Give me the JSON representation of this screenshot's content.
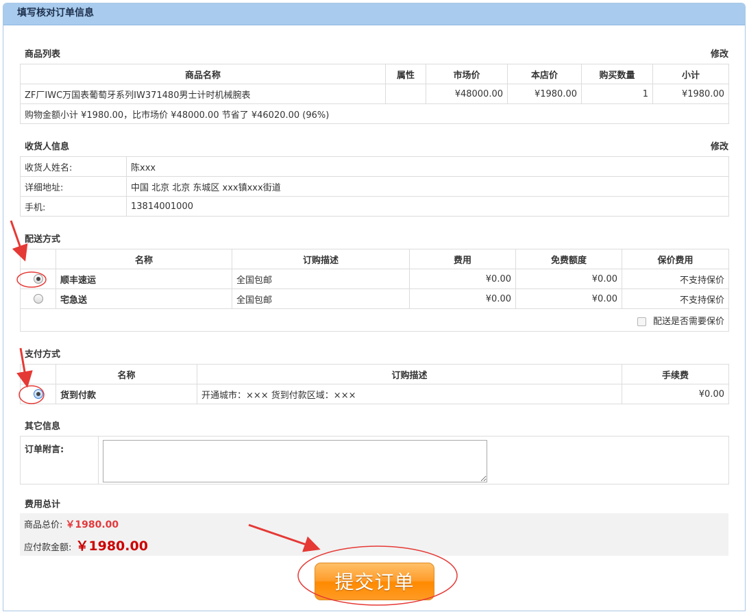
{
  "header": {
    "title": "填写核对订单信息"
  },
  "goods": {
    "title": "商品列表",
    "edit_label": "修改",
    "columns": [
      "商品名称",
      "属性",
      "市场价",
      "本店价",
      "购买数量",
      "小计"
    ],
    "rows": [
      {
        "name": "ZF厂IWC万国表葡萄牙系列IW371480男士计时机械腕表",
        "attr": "",
        "market": "¥48000.00",
        "shop": "¥1980.00",
        "qty": "1",
        "subtotal": "¥1980.00"
      }
    ],
    "summary": "购物金额小计 ¥1980.00，比市场价 ¥48000.00 节省了 ¥46020.00 (96%)"
  },
  "consignee": {
    "title": "收货人信息",
    "edit_label": "修改",
    "rows": [
      {
        "label": "收货人姓名:",
        "value": "陈xxx"
      },
      {
        "label": "详细地址:",
        "value": "中国 北京 北京 东城区 xxx镇xxx街道"
      },
      {
        "label": "手机:",
        "value": "13814001000"
      }
    ]
  },
  "shipping": {
    "title": "配送方式",
    "columns": [
      "名称",
      "订购描述",
      "费用",
      "免费额度",
      "保价费用"
    ],
    "rows": [
      {
        "name": "顺丰速运",
        "desc": "全国包邮",
        "fee": "¥0.00",
        "free": "¥0.00",
        "insure": "不支持保价",
        "selected": true
      },
      {
        "name": "宅急送",
        "desc": "全国包邮",
        "fee": "¥0.00",
        "free": "¥0.00",
        "insure": "不支持保价",
        "selected": false
      }
    ],
    "insure_label": "配送是否需要保价"
  },
  "payment": {
    "title": "支付方式",
    "columns": [
      "名称",
      "订购描述",
      "手续费"
    ],
    "rows": [
      {
        "name": "货到付款",
        "desc": "开通城市：××× 货到付款区域：×××",
        "fee": "¥0.00",
        "selected": true
      }
    ]
  },
  "other": {
    "title": "其它信息",
    "note_label": "订单附言:"
  },
  "total": {
    "title": "费用总计",
    "goods_label": "商品总价:",
    "goods_value": "￥1980.00",
    "pay_label": "应付款金额:",
    "pay_value": "￥1980.00"
  },
  "submit": {
    "label": "提交订单"
  },
  "colors": {
    "header_bg": "#a8cbee",
    "price": "#e4393c",
    "button": "#ff9c2a",
    "annotation": "#e53935"
  }
}
